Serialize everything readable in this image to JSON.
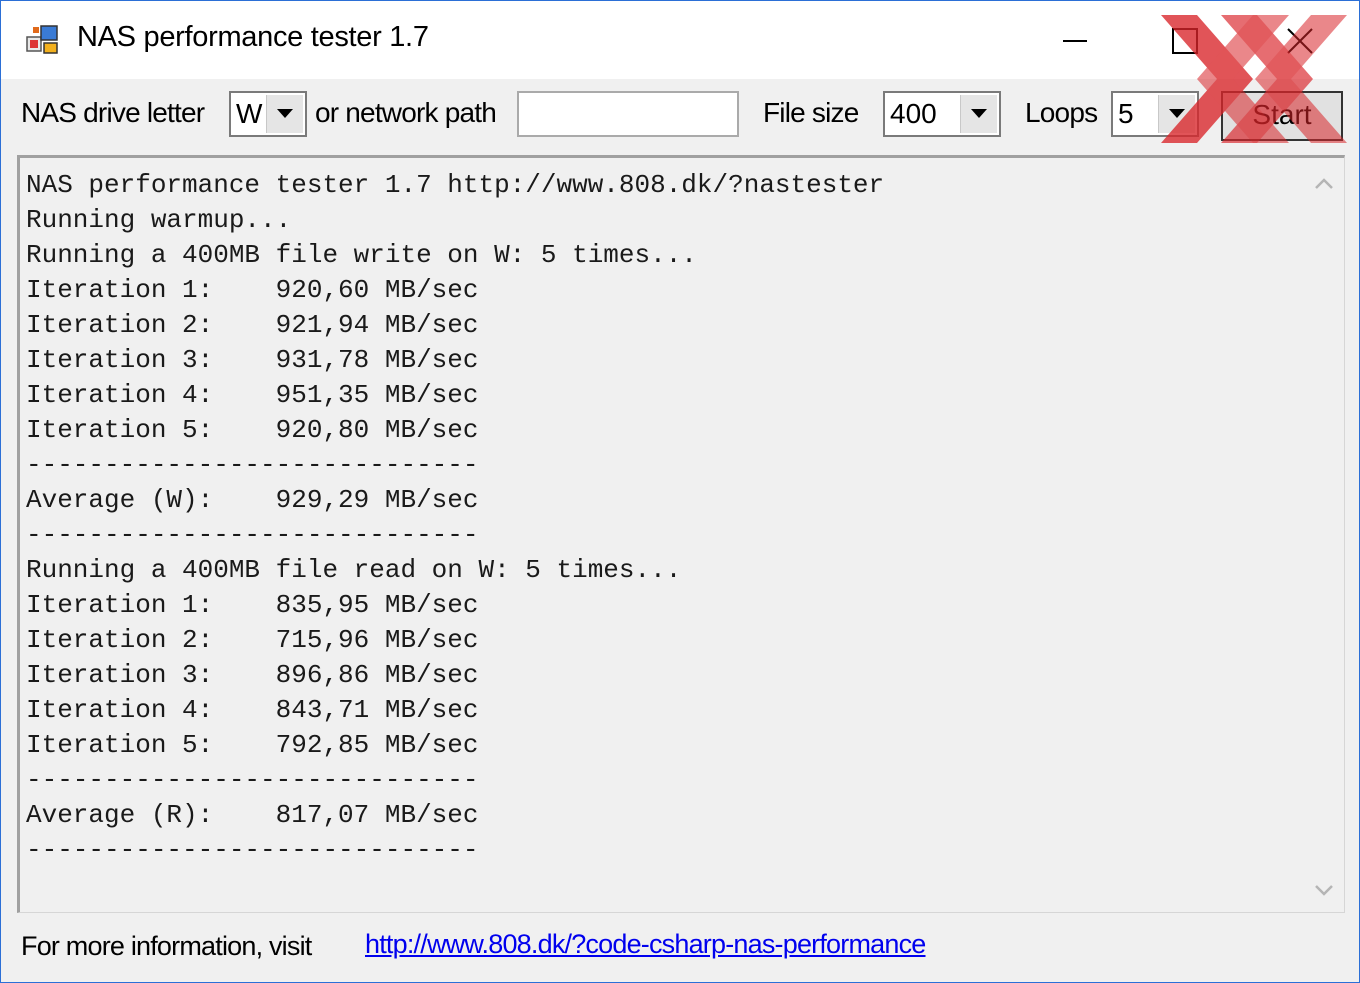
{
  "window": {
    "title": "NAS performance tester 1.7",
    "icon": "app-icon",
    "controls": [
      "minimize-icon",
      "maximize-icon",
      "close-icon"
    ]
  },
  "toolbar": {
    "drive_label": "NAS drive letter",
    "drive_value": "W",
    "path_label": "or network path",
    "path_value": "",
    "filesize_label": "File size",
    "filesize_value": "400",
    "loops_label": "Loops",
    "loops_value": "5",
    "start_label": "Start"
  },
  "output": {
    "lines": [
      "NAS performance tester 1.7 http://www.808.dk/?nastester",
      "Running warmup...",
      "Running a 400MB file write on W: 5 times...",
      "Iteration 1:    920,60 MB/sec",
      "Iteration 2:    921,94 MB/sec",
      "Iteration 3:    931,78 MB/sec",
      "Iteration 4:    951,35 MB/sec",
      "Iteration 5:    920,80 MB/sec",
      "-----------------------------",
      "Average (W):    929,29 MB/sec",
      "-----------------------------",
      "Running a 400MB file read on W: 5 times...",
      "Iteration 1:    835,95 MB/sec",
      "Iteration 2:    715,96 MB/sec",
      "Iteration 3:    896,86 MB/sec",
      "Iteration 4:    843,71 MB/sec",
      "Iteration 5:    792,85 MB/sec",
      "-----------------------------",
      "Average (R):    817,07 MB/sec",
      "-----------------------------"
    ]
  },
  "footer": {
    "label": "For more information, visit",
    "link": "http://www.808.dk/?code-csharp-nas-performance"
  },
  "colors": {
    "window_border": "#2b6fd6",
    "link": "#0000ee",
    "watermark": "#d9252a"
  }
}
